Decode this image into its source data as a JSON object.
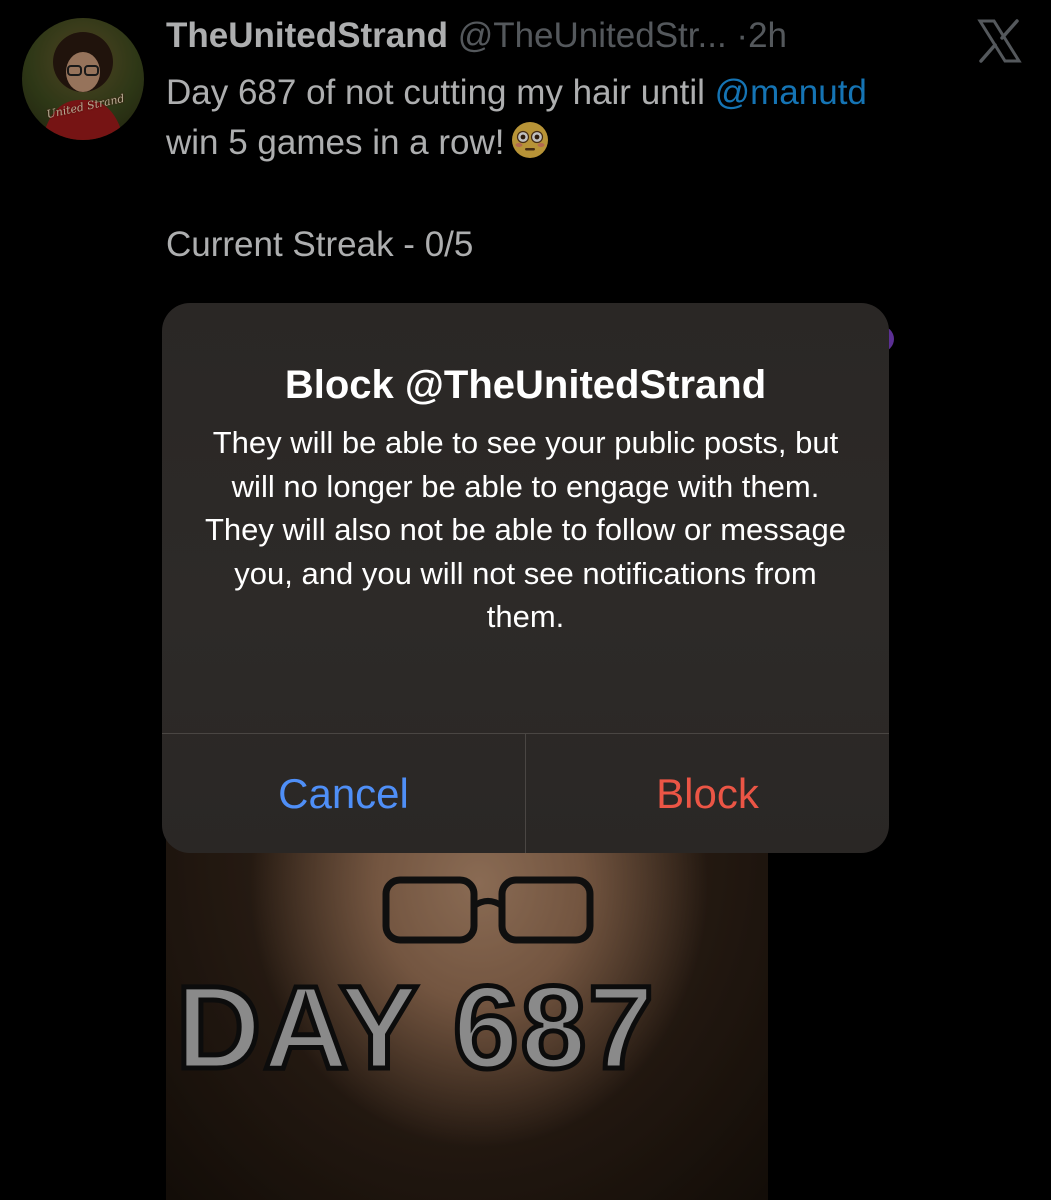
{
  "tweet": {
    "display_name": "TheUnitedStrand",
    "handle": "@TheUnitedStr...",
    "separator": "·",
    "time": "2h",
    "text_before_mention": "Day 687 of not cutting my hair until ",
    "mention": "@manutd",
    "text_after_mention": " win 5 games in a row!",
    "emoji": "flushed-face",
    "streak_line": "Current Streak - 0/5",
    "avatar_badge_text": "United Strand",
    "media_overlay_text": "DAY 687"
  },
  "alert": {
    "title": "Block @TheUnitedStrand",
    "message": "They will be able to see your public posts, but will no longer be able to engage with them. They will also not be able to follow or message you, and you will not see notifications from them.",
    "cancel_label": "Cancel",
    "confirm_label": "Block"
  },
  "colors": {
    "background": "#000000",
    "mention": "#1d9bf0",
    "secondary_text": "#71767b",
    "cancel": "#4f8ff7",
    "destructive": "#eb5545",
    "alert_bg": "#2b2826"
  },
  "icons": {
    "close": "x-logo-icon"
  }
}
